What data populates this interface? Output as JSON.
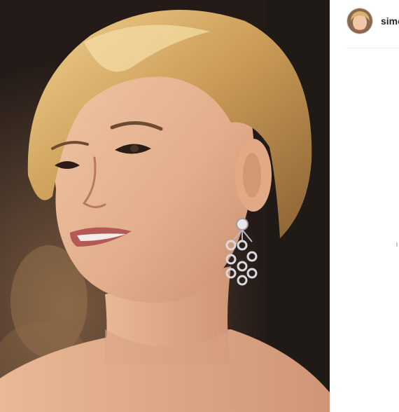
{
  "post": {
    "author": {
      "username": "simo"
    },
    "photo": {
      "icon": "portrait-photo"
    }
  },
  "colors": {
    "username": "#262626",
    "divider": "#efefef",
    "background": "#ffffff"
  }
}
